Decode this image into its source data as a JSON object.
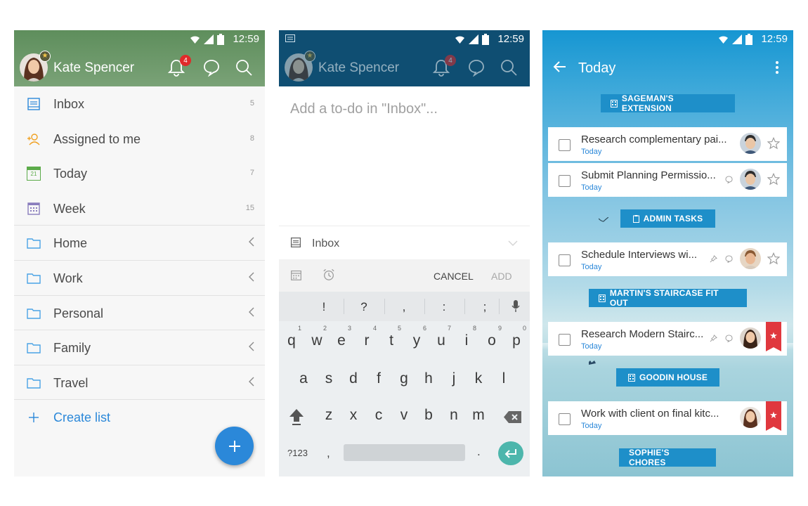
{
  "status_bar": {
    "time": "12:59"
  },
  "panel1": {
    "user_name": "Kate Spencer",
    "notifications_count": "4",
    "lists": [
      {
        "label": "Inbox",
        "count": "5",
        "icon": "inbox-icon"
      },
      {
        "label": "Assigned to me",
        "count": "8",
        "icon": "assigned-person-icon"
      },
      {
        "label": "Today",
        "count": "7",
        "icon": "calendar-today-icon",
        "date_num": "21"
      },
      {
        "label": "Week",
        "count": "15",
        "icon": "calendar-week-icon"
      }
    ],
    "folders": [
      {
        "label": "Home",
        "icon": "folder-icon"
      },
      {
        "label": "Work",
        "icon": "folder-icon"
      },
      {
        "label": "Personal",
        "icon": "folder-icon"
      },
      {
        "label": "Family",
        "icon": "folder-icon"
      },
      {
        "label": "Travel",
        "icon": "folder-icon"
      }
    ],
    "create_list": "Create list",
    "fab": "+"
  },
  "panel2": {
    "user_name": "Kate Spencer",
    "notifications_count": "4",
    "placeholder": "Add a to-do in \"Inbox\"...",
    "selected_list": "Inbox",
    "cancel_label": "CANCEL",
    "add_label": "ADD",
    "keyboard": {
      "symbols": [
        "!",
        "?",
        ",",
        ":",
        ";"
      ],
      "row1": [
        "q",
        "w",
        "e",
        "r",
        "t",
        "y",
        "u",
        "i",
        "o",
        "p"
      ],
      "row1_hints": [
        "1",
        "2",
        "3",
        "4",
        "5",
        "6",
        "7",
        "8",
        "9",
        "0"
      ],
      "row2": [
        "a",
        "s",
        "d",
        "f",
        "g",
        "h",
        "j",
        "k",
        "l"
      ],
      "row3": [
        "z",
        "x",
        "c",
        "v",
        "b",
        "n",
        "m"
      ],
      "mode_key": "?123",
      "comma": ",",
      "period": "."
    }
  },
  "panel3": {
    "title": "Today",
    "sections": [
      {
        "name": "SAGEMAN'S EXTENSION",
        "icon": "building-icon"
      },
      {
        "name": "ADMIN TASKS",
        "icon": "clipboard-icon"
      },
      {
        "name": "MARTIN'S STAIRCASE FIT OUT",
        "icon": "building-icon"
      },
      {
        "name": "GOODIN HOUSE",
        "icon": "building-icon"
      },
      {
        "name": "SOPHIE'S CHORES",
        "icon": ""
      }
    ],
    "tasks": [
      {
        "title": "Research complementary pai...",
        "due": "Today",
        "starred": false
      },
      {
        "title": "Submit Planning Permissio...",
        "due": "Today",
        "starred": false
      },
      {
        "title": "Schedule Interviews wi...",
        "due": "Today",
        "starred": false
      },
      {
        "title": "Research Modern Stairc...",
        "due": "Today",
        "starred": true
      },
      {
        "title": "Work with client on final kitc...",
        "due": "Today",
        "starred": true
      }
    ]
  },
  "colors": {
    "panel1_header": "#6f9a6c",
    "panel2_header": "#0f4e72",
    "accent_blue": "#2b88d9",
    "section_blue": "#1e8fc9",
    "star_ribbon": "#e0383e",
    "badge_red": "#e02a2a"
  }
}
